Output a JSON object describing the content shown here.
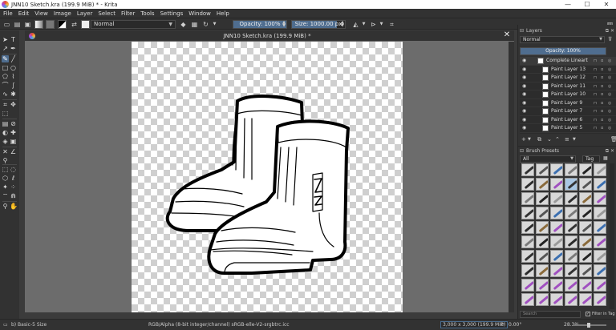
{
  "window": {
    "title": "JNN10 Sketch.kra (199.9 MiB) * - Krita",
    "controls": [
      "—",
      "☐",
      "✕"
    ]
  },
  "menu": [
    "File",
    "Edit",
    "View",
    "Image",
    "Layer",
    "Select",
    "Filter",
    "Tools",
    "Settings",
    "Window",
    "Help"
  ],
  "tool_options": {
    "blend_mode": "Normal",
    "opacity_label": "Opacity: 100%",
    "opacity_value": 1.0,
    "size_label": "Size: 1000.00 px",
    "size_fill": 0.85
  },
  "document": {
    "tab_title": "JNN10 Sketch.kra (199.9 MiB) *",
    "close": "✕"
  },
  "layers_docker": {
    "title": "Layers",
    "blend_mode": "Normal",
    "opacity_label": "Opacity:  100%",
    "layers": [
      {
        "name": "Complete Lineart",
        "group": true
      },
      {
        "name": "Paint Layer 13",
        "group": false
      },
      {
        "name": "Paint Layer 12",
        "group": false
      },
      {
        "name": "Paint Layer 11",
        "group": false
      },
      {
        "name": "Paint Layer 10",
        "group": false
      },
      {
        "name": "Paint Layer 9",
        "group": false
      },
      {
        "name": "Paint Layer 7",
        "group": false
      },
      {
        "name": "Paint Layer 6",
        "group": false
      },
      {
        "name": "Paint Layer 5",
        "group": false
      }
    ]
  },
  "brush_docker": {
    "title": "Brush Presets",
    "filter": "All",
    "tag": "Tag",
    "search_placeholder": "Search",
    "filter_in_tag": "Filter in Tag",
    "stroke_colors": [
      "#333333",
      "#555555",
      "#3b6fb0",
      "#7a7a7a",
      "#222222",
      "#9a9a9a",
      "#2c2c2c",
      "#8a6a3a",
      "#a050c0"
    ]
  },
  "status": {
    "brush": "b) Basic-5 Size",
    "color_info": "RGB/Alpha (8-bit integer/channel)  sRGB-elle-V2-srgbtrc.icc",
    "image_size": "3,000 x 3,000 (199.9 MiB)",
    "rotation": "0.00°",
    "zoom": "28.3%"
  },
  "colors": {
    "accent": "#4f6d8f",
    "panel": "#323232",
    "canvas_bg": "#6c6c6c"
  }
}
